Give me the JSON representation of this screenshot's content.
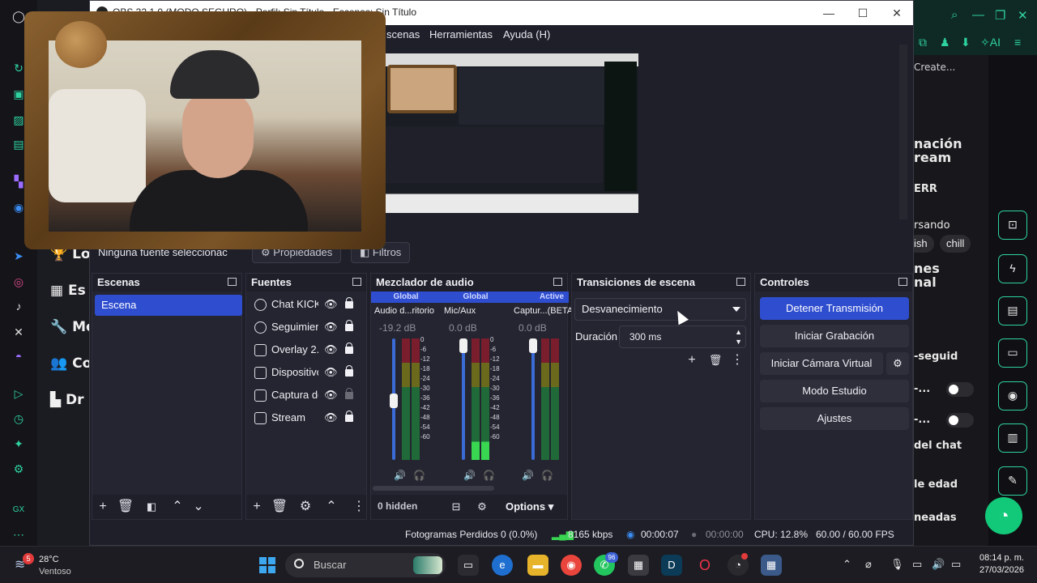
{
  "window": {
    "title": "OBS 32.1.0 (MODO SEGURO) - Perfil: Sin Título - Escenas: Sin Título",
    "minimize": "—",
    "maximize": "☐",
    "close": "✕"
  },
  "menu": [
    "scenas",
    "Herramientas",
    "Ayuda (H)"
  ],
  "source_toolbar": {
    "selected_text": "Ninguna fuente seleccionac",
    "properties_label": "Propiedades",
    "filters_label": "Filtros"
  },
  "scenes": {
    "title": "Escenas",
    "items": [
      "Escena"
    ]
  },
  "sources": {
    "title": "Fuentes",
    "items": [
      {
        "label": "Chat KICK",
        "icon": "browser-icon",
        "locked": true
      },
      {
        "label": "Seguimien",
        "icon": "browser-icon",
        "locked": true
      },
      {
        "label": "Overlay 2.0",
        "icon": "image-icon",
        "locked": true
      },
      {
        "label": "Dispositivo",
        "icon": "camera-icon",
        "locked": true
      },
      {
        "label": "Captura de",
        "icon": "window-capture-icon",
        "locked": false
      },
      {
        "label": "Stream",
        "icon": "display-icon",
        "locked": true
      }
    ]
  },
  "mixer": {
    "title": "Mezclador de audio",
    "channels": [
      {
        "badge": "Global",
        "name": "Audio d...ritorio",
        "db": "-19.2 dB",
        "level": 0.45
      },
      {
        "badge": "Global",
        "name": "Mic/Aux",
        "db": "0.0 dB",
        "level": 1.0
      },
      {
        "badge": "Active",
        "name": "Captur...(BETA)",
        "db": "0.0 dB",
        "level": 1.0
      }
    ],
    "ticks": [
      "0",
      "-6",
      "-12",
      "-18",
      "-24",
      "-30",
      "-36",
      "-42",
      "-48",
      "-54",
      "-60"
    ],
    "hidden_label": "0 hidden",
    "options_label": "Options"
  },
  "transitions": {
    "title": "Transiciones de escena",
    "selected": "Desvanecimiento",
    "duration_label": "Duración",
    "duration_value": "300 ms"
  },
  "controls": {
    "title": "Controles",
    "buttons": [
      "Detener Transmisión",
      "Iniciar Grabación",
      "Iniciar Cámara Virtual",
      "Modo Estudio",
      "Ajustes"
    ]
  },
  "status": {
    "dropped": "Fotogramas Perdidos 0 (0.0%)",
    "bitrate": "8165 kbps",
    "stream_time": "00:00:07",
    "rec_time": "00:00:00",
    "cpu": "CPU: 12.8%",
    "fps": "60.00 / 60.00 FPS"
  },
  "left_web": [
    "Lo",
    "Es",
    "Mo",
    "Co",
    "Dr"
  ],
  "right_panel": {
    "create": "Create...",
    "heading_1": "nación",
    "heading_2": "ream",
    "err": "ERR",
    "conversando": "rsando",
    "chip_1": "ish",
    "chip_2": "chill",
    "nes_1": "nes",
    "nes_2": "nal",
    "seguidores": "-seguid",
    "dots_1": "-...",
    "dots_2": "-...",
    "del_chat": "del chat",
    "edad": "le edad",
    "baneadas": "neadas"
  },
  "taskbar": {
    "weather_temp": "28°C",
    "weather_desc": "Ventoso",
    "weather_badge": "5",
    "search_placeholder": "Buscar",
    "whatsapp_badge": "96",
    "time": "08:14 p. m.",
    "date": "27/03/2026"
  }
}
